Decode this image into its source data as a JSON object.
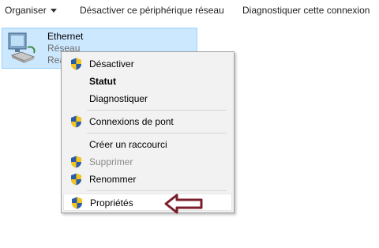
{
  "toolbar": {
    "organise_label": "Organiser",
    "disable_label": "Désactiver ce périphérique réseau",
    "diagnose_label": "Diagnostiquer cette connexion"
  },
  "network_item": {
    "name": "Ethernet",
    "type": "Réseau",
    "status_partial": "Rea",
    "icon": "network-adapter-icon"
  },
  "context_menu": {
    "items": [
      {
        "label": "Désactiver",
        "shield": true
      },
      {
        "label": "Statut",
        "bold": true
      },
      {
        "label": "Diagnostiquer"
      },
      {
        "label": "Connexions de pont",
        "shield": true
      },
      {
        "label": "Créer un raccourci"
      },
      {
        "label": "Supprimer",
        "shield": true,
        "disabled": true
      },
      {
        "label": "Renommer",
        "shield": true
      },
      {
        "label": "Propriétés",
        "shield": true,
        "highlighted": true
      }
    ]
  },
  "colors": {
    "selection_bg": "#cce8ff",
    "selection_border": "#99d1ff",
    "menu_bg": "#f2f2f2",
    "arrow": "#7a1f2b"
  }
}
